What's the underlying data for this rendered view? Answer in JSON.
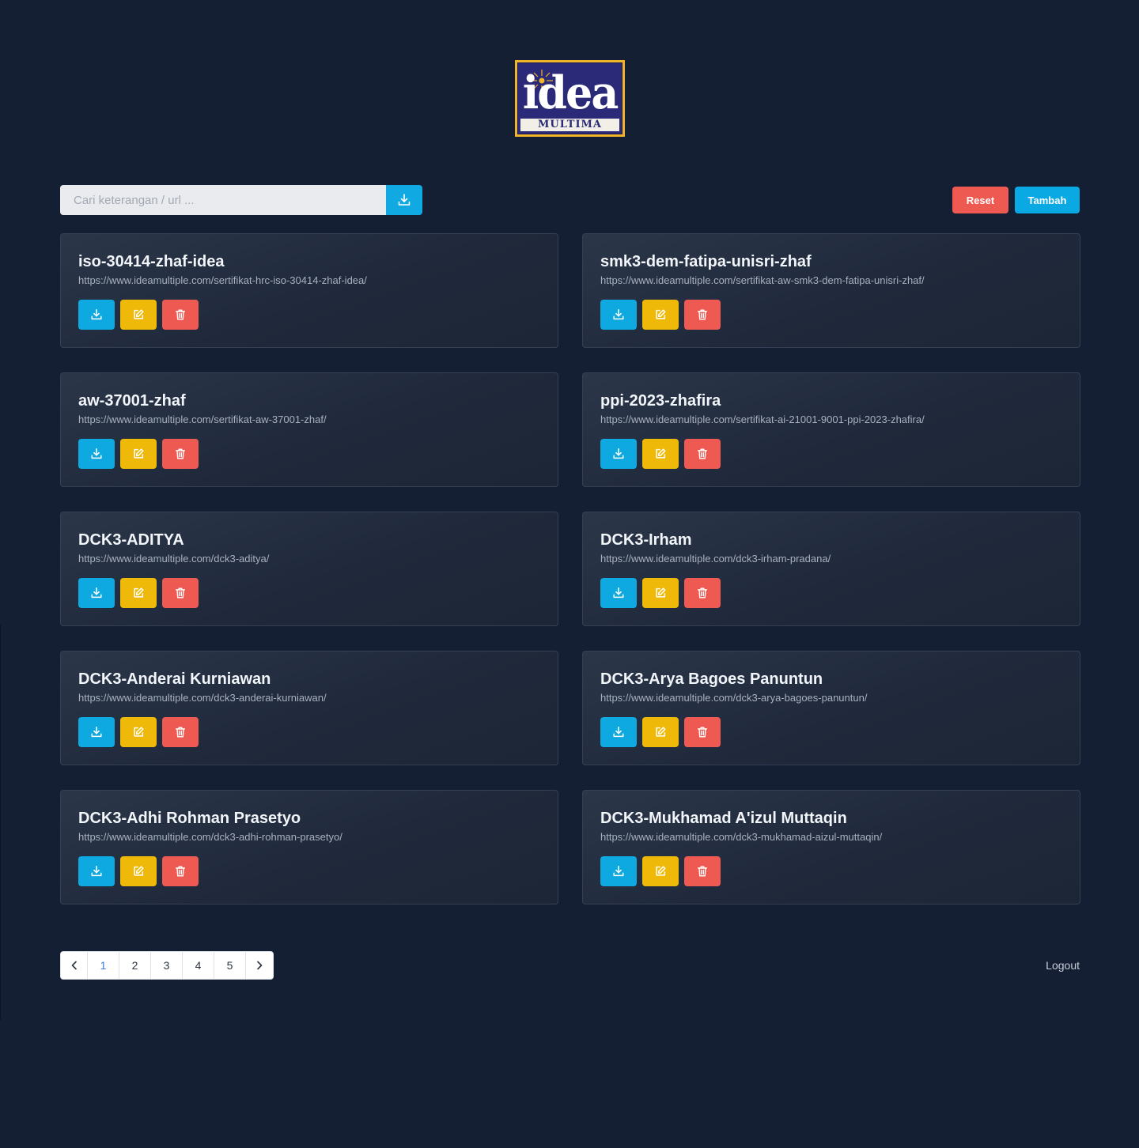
{
  "brand": {
    "logo_word": "idea",
    "logo_sub": "MULTIMA",
    "colors": {
      "frame": "#f0b52a",
      "field": "#2b2a78"
    }
  },
  "search": {
    "placeholder": "Cari keterangan / url ...",
    "value": "",
    "button_icon": "download-icon"
  },
  "toolbar": {
    "reset_label": "Reset",
    "add_label": "Tambah"
  },
  "cards": [
    {
      "title": "iso-30414-zhaf-idea",
      "url": "https://www.ideamultiple.com/sertifikat-hrc-iso-30414-zhaf-idea/"
    },
    {
      "title": "smk3-dem-fatipa-unisri-zhaf",
      "url": "https://www.ideamultiple.com/sertifikat-aw-smk3-dem-fatipa-unisri-zhaf/"
    },
    {
      "title": "aw-37001-zhaf",
      "url": "https://www.ideamultiple.com/sertifikat-aw-37001-zhaf/"
    },
    {
      "title": "ppi-2023-zhafira",
      "url": "https://www.ideamultiple.com/sertifikat-ai-21001-9001-ppi-2023-zhafira/"
    },
    {
      "title": "DCK3-ADITYA",
      "url": "https://www.ideamultiple.com/dck3-aditya/"
    },
    {
      "title": "DCK3-Irham",
      "url": "https://www.ideamultiple.com/dck3-irham-pradana/"
    },
    {
      "title": "DCK3-Anderai Kurniawan",
      "url": "https://www.ideamultiple.com/dck3-anderai-kurniawan/"
    },
    {
      "title": "DCK3-Arya Bagoes Panuntun",
      "url": "https://www.ideamultiple.com/dck3-arya-bagoes-panuntun/"
    },
    {
      "title": "DCK3-Adhi Rohman Prasetyo",
      "url": "https://www.ideamultiple.com/dck3-adhi-rohman-prasetyo/"
    },
    {
      "title": "DCK3-Mukhamad A'izul Muttaqin",
      "url": "https://www.ideamultiple.com/dck3-mukhamad-aizul-muttaqin/"
    }
  ],
  "card_actions": {
    "download_icon": "download-icon",
    "edit_icon": "edit-icon",
    "delete_icon": "trash-icon",
    "colors": {
      "download": "#0fa9e1",
      "edit": "#efb90a",
      "delete": "#ee5a52"
    }
  },
  "pagination": {
    "prev_icon": "chevron-left-icon",
    "next_icon": "chevron-right-icon",
    "pages": [
      "1",
      "2",
      "3",
      "4",
      "5"
    ],
    "current": "1"
  },
  "footer": {
    "logout_label": "Logout"
  }
}
